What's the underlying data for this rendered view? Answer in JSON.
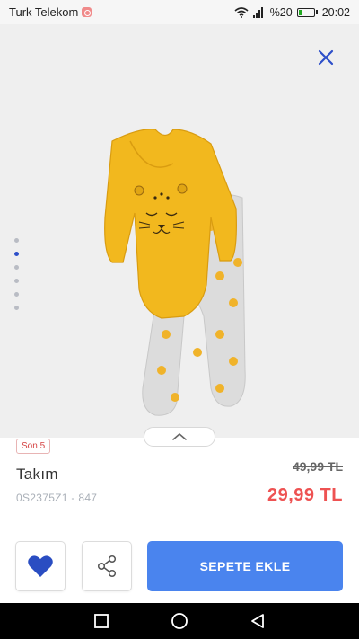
{
  "status_bar": {
    "carrier": "Turk Telekom",
    "signal_label": ".ıll",
    "battery_percent": "%20",
    "battery_level": 0.2,
    "time": "20:02"
  },
  "product": {
    "badge": "Son 5",
    "title": "Takım",
    "code": "0S2375Z1 - 847",
    "old_price": "49,99 TL",
    "new_price": "29,99 TL"
  },
  "gallery": {
    "dot_count": 6,
    "active_index": 1
  },
  "actions": {
    "add_to_cart": "SEPETE EKLE"
  },
  "colors": {
    "accent_blue": "#4a84ee",
    "heart_blue": "#2a4dc2",
    "price_red": "#ee5252",
    "garment_yellow": "#f2b81e"
  },
  "icons": {
    "close": "close-icon",
    "favorite": "heart-icon",
    "share": "share-icon",
    "expand": "chevron-up-icon",
    "nav_recent": "square-icon",
    "nav_home": "circle-icon",
    "nav_back": "triangle-back-icon"
  }
}
